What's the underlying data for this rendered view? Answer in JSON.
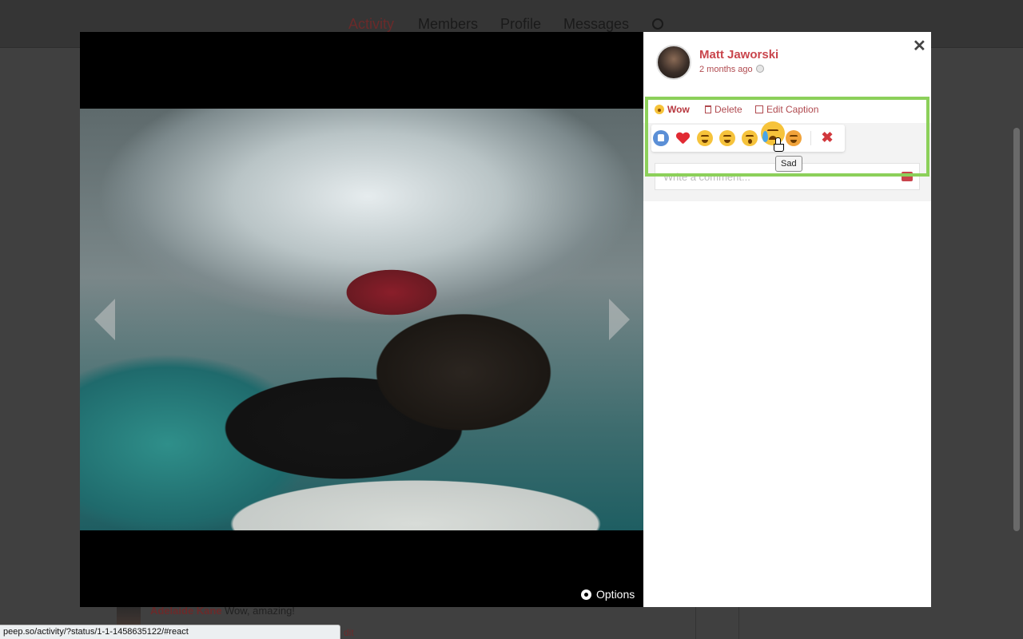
{
  "background": {
    "nav": [
      "Activity",
      "Members",
      "Profile",
      "Messages"
    ],
    "comment": {
      "author": "Adelaide Kane",
      "text": "Wow, amazing!",
      "edit_label": "dit"
    }
  },
  "viewer": {
    "options_label": "Options"
  },
  "post": {
    "author": "Matt Jaworski",
    "time": "2 months ago",
    "actions": {
      "reaction_label": "Wow",
      "delete_label": "Delete",
      "edit_caption_label": "Edit Caption"
    },
    "reactions": [
      "like",
      "love",
      "laugh",
      "wink",
      "wow",
      "sad",
      "angry"
    ],
    "hovered_reaction_tooltip": "Sad",
    "comment": {
      "placeholder": "Write a comment..."
    }
  },
  "status_bar": {
    "url": "peep.so/activity/?status/1-1-1458635122/#react"
  },
  "colors": {
    "accent": "#c9454c",
    "highlight": "#8cd05a"
  }
}
